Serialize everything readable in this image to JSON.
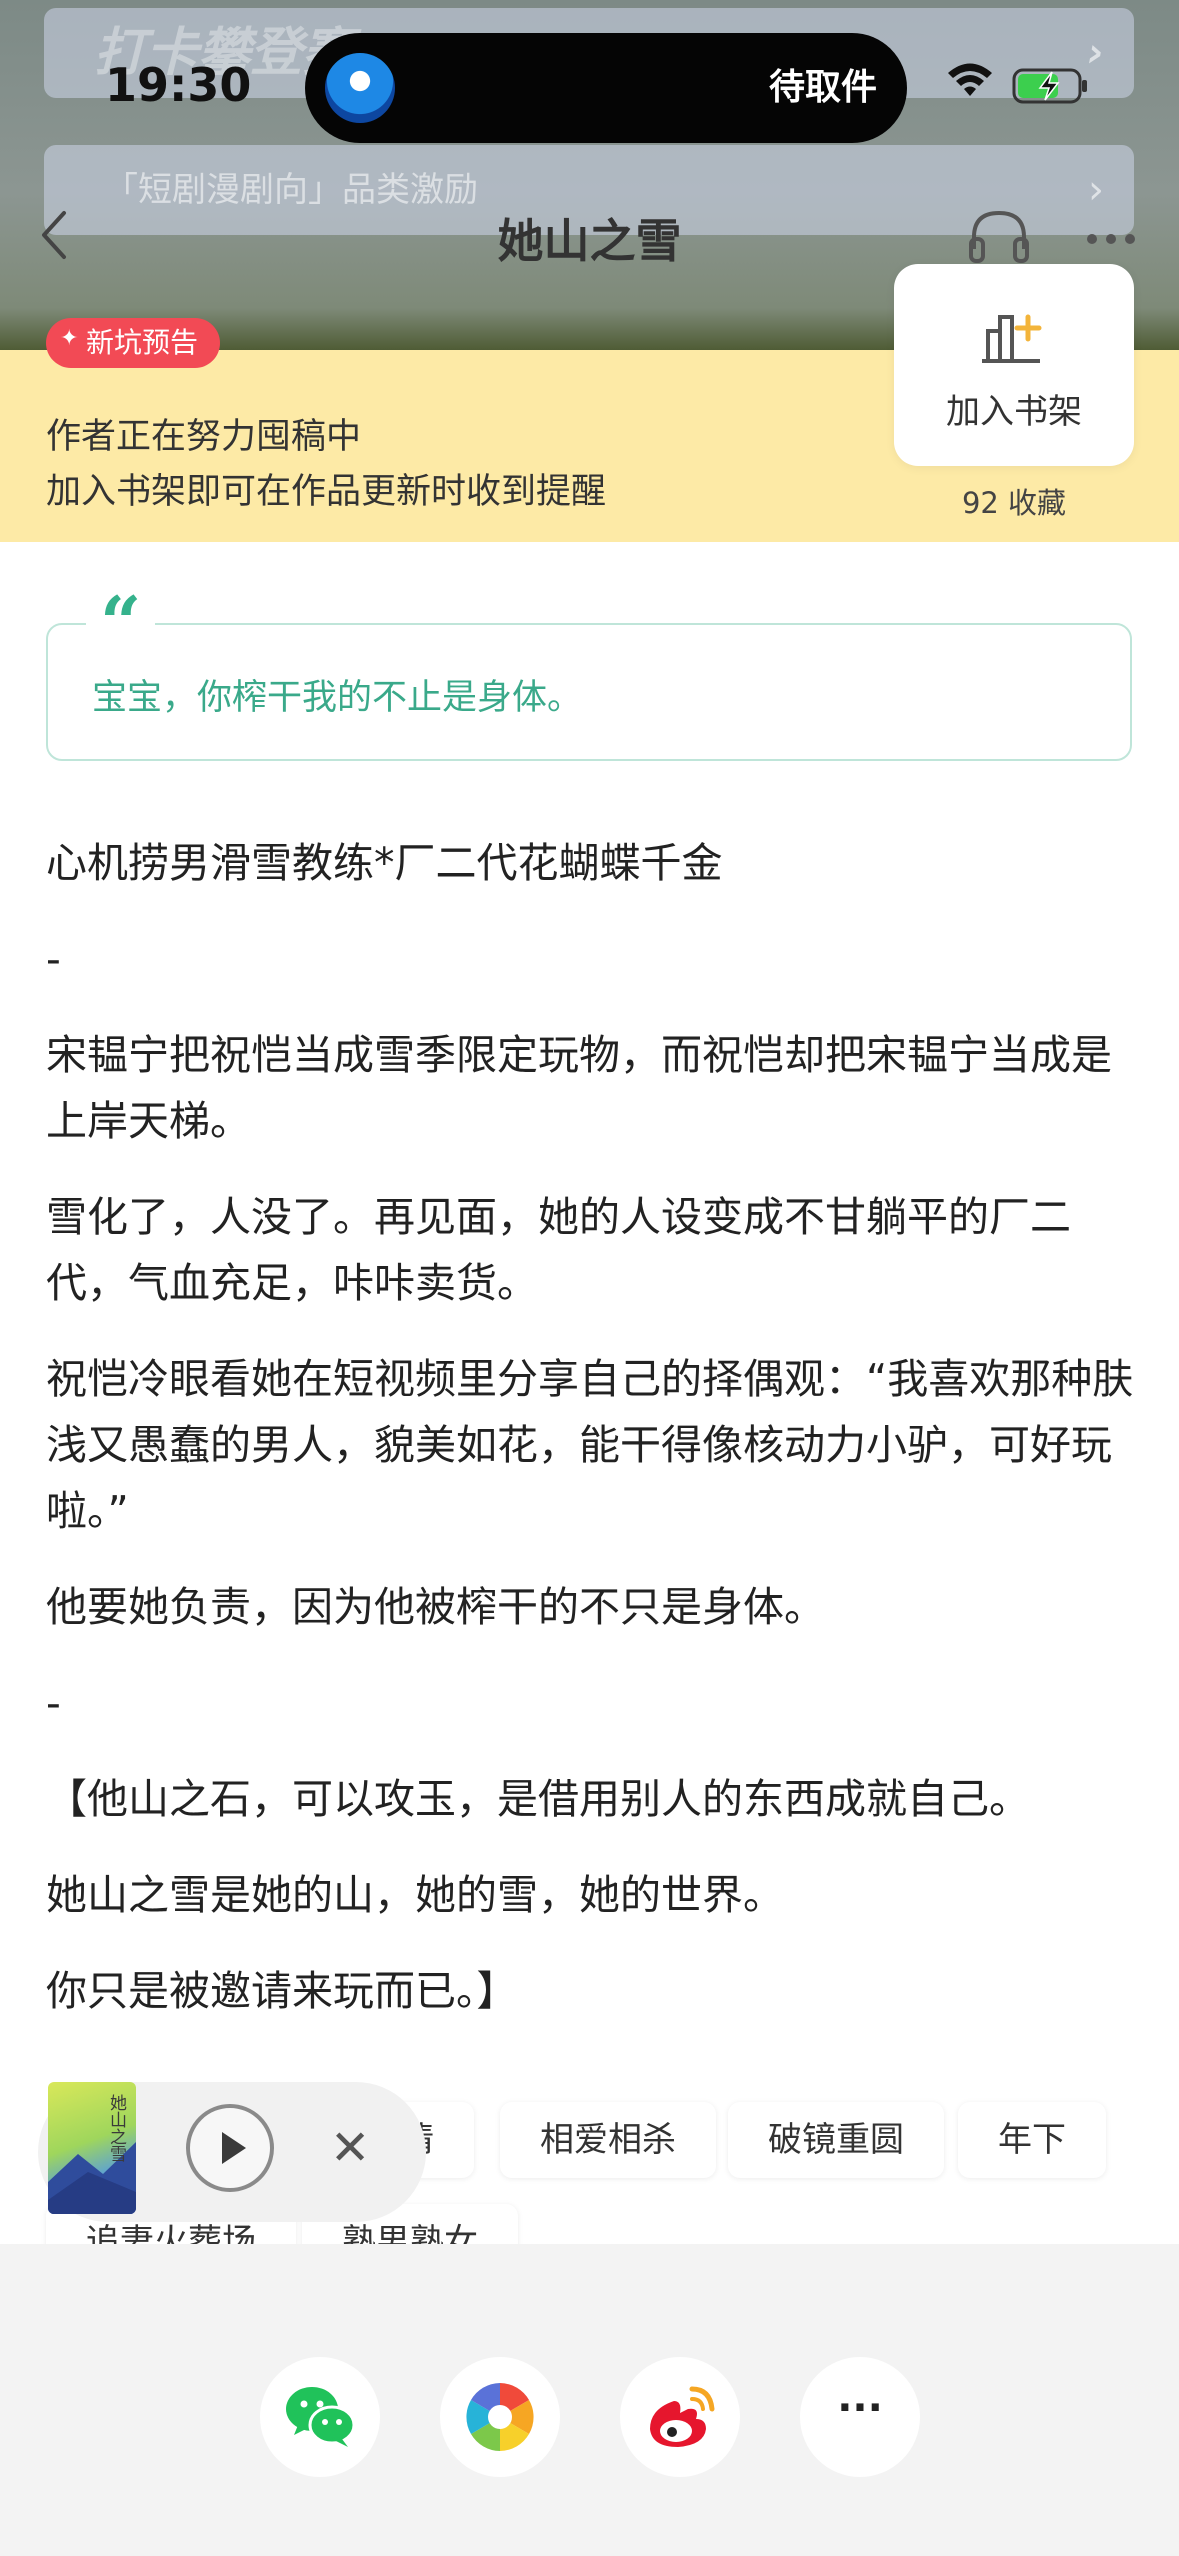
{
  "status_bar": {
    "time": "19:30",
    "island_text": "待取件"
  },
  "background_promos": [
    {
      "label": "打卡攀登赛"
    },
    {
      "label": "「短剧漫剧向」品类激励"
    }
  ],
  "nav": {
    "title": "她山之雪",
    "back_icon": "chevron-left-icon",
    "listen_icon": "headphones-icon",
    "more_icon": "more-horizontal-icon"
  },
  "banner": {
    "badge": "新坑预告",
    "line1": "作者正在努力囤稿中",
    "line2": "加入书架即可在作品更新时收到提醒",
    "shelf_button_label": "加入书架",
    "collect_count": "92 收藏",
    "background_color": "#fdeaa6",
    "badge_color": "#f24a55"
  },
  "quote": {
    "mark": "“",
    "text": "宝宝，你榨干我的不止是身体。",
    "color": "#3aa98a"
  },
  "description": [
    "心机捞男滑雪教练*厂二代花蝴蝶千金",
    "-",
    "宋韫宁把祝恺当成雪季限定玩物，而祝恺却把宋韫宁当成是上岸天梯。",
    "雪化了，人没了。再见面，她的人设变成不甘躺平的厂二代，气血充足，咔咔卖货。",
    "祝恺冷眼看她在短视频里分享自己的择偶观：“我喜欢那种肤浅又愚蠢的男人，貌美如花，能干得像核动力小驴，可好玩啦。”",
    "他要她负责，因为他被榨干的不只是身体。",
    "-",
    "【他山之石，可以攻玉，是借用别人的东西成就自己。",
    "她山之雪是她的山，她的雪，她的世界。",
    "你只是被邀请来玩而已。】"
  ],
  "tags": [
    "情",
    "相爱相杀",
    "破镜重圆",
    "年下",
    "追妻火葬场",
    "熟男熟女"
  ],
  "player": {
    "cover_title": "她山之雪",
    "play_icon": "play-icon",
    "close_icon": "close-icon"
  },
  "share": [
    {
      "name": "wechat",
      "icon": "wechat-icon"
    },
    {
      "name": "moments",
      "icon": "moments-icon"
    },
    {
      "name": "weibo",
      "icon": "weibo-icon"
    },
    {
      "name": "more",
      "label": "···"
    }
  ]
}
